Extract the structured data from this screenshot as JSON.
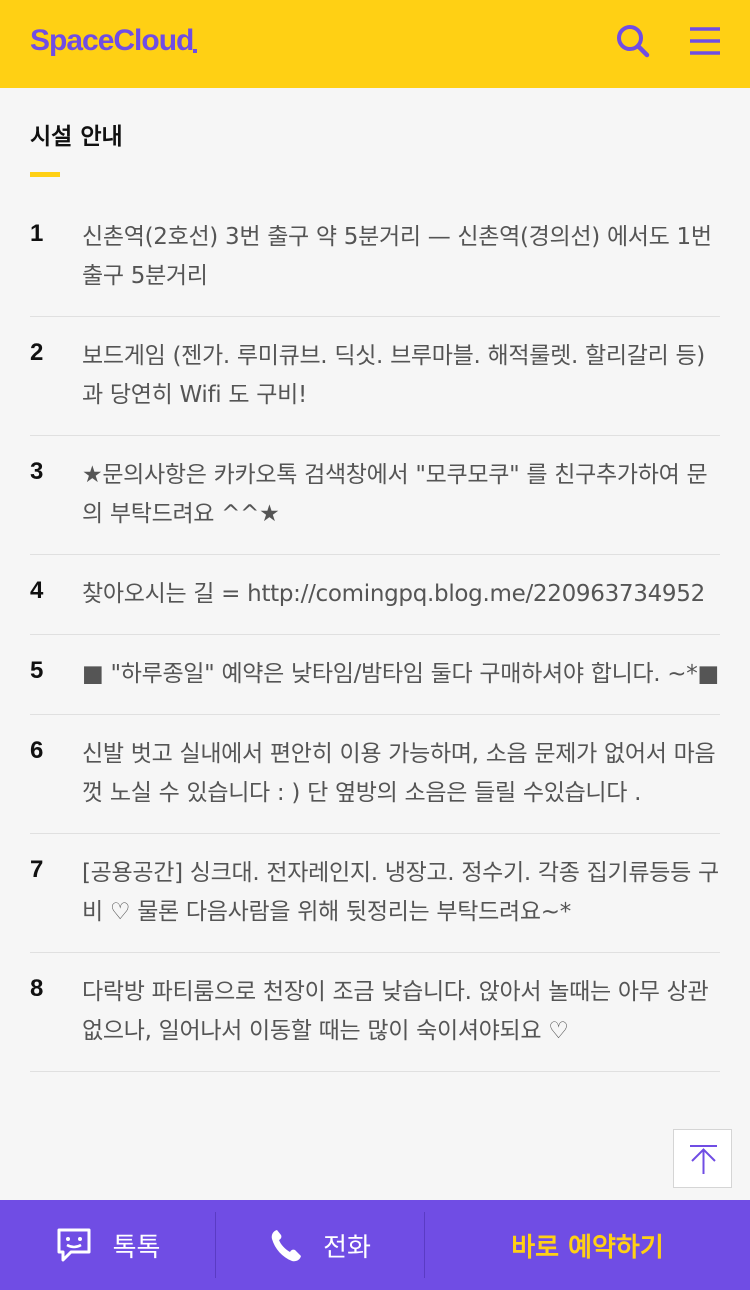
{
  "header": {
    "logo": "SpaceCloud",
    "brand_color": "#704de4",
    "accent_color": "#ffd014",
    "icons": [
      "search-icon",
      "menu-icon"
    ]
  },
  "section": {
    "title": "시설 안내"
  },
  "facility_items": [
    {
      "num": "1",
      "text": "신촌역(2호선) 3번 출구 약 5분거리 — 신촌역(경의선) 에서도 1번 출구 5분거리"
    },
    {
      "num": "2",
      "text": "보드게임 (젠가. 루미큐브. 딕싯. 브루마블. 해적룰렛. 할리갈리 등) 과 당연히 Wifi 도 구비!"
    },
    {
      "num": "3",
      "text": "★문의사항은 카카오톡 검색창에서 \"모쿠모쿠\" 를 친구추가하여 문의 부탁드려요 ^^★"
    },
    {
      "num": "4",
      "text": "찾아오시는 길 = http://comingpq.blog.me/220963734952"
    },
    {
      "num": "5",
      "text": "■ \"하루종일\" 예약은 낮타임/밤타임 둘다 구매하셔야 합니다. ~*■"
    },
    {
      "num": "6",
      "text": "신발 벗고 실내에서 편안히 이용 가능하며, 소음 문제가 없어서 마음껏 노실 수 있습니다 : ) 단 옆방의 소음은 들릴 수있습니다 ."
    },
    {
      "num": "7",
      "text": "[공용공간] 싱크대. 전자레인지. 냉장고. 정수기. 각종 집기류등등 구비 ♡ 물론 다음사람을 위해 뒷정리는 부탁드려요~*"
    },
    {
      "num": "8",
      "text": "다락방 파티룸으로 천장이 조금 낮습니다. 앉아서 놀때는 아무 상관 없으나, 일어나서 이동할 때는 많이 숙이셔야되요 ♡"
    }
  ],
  "scroll_top": {
    "icon": "arrow-up-icon"
  },
  "bottom_bar": {
    "talk_label": "톡톡",
    "call_label": "전화",
    "book_label": "바로 예약하기"
  }
}
